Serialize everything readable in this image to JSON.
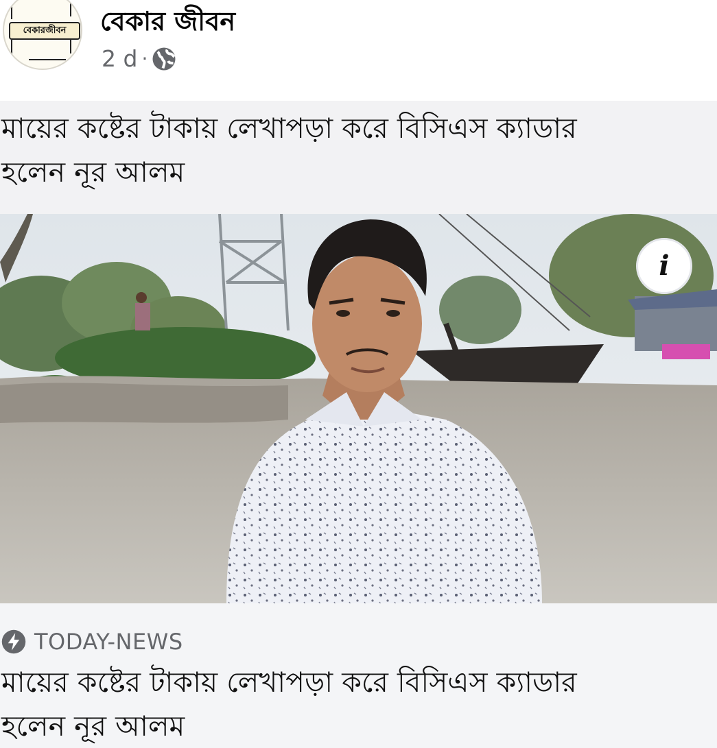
{
  "post": {
    "page_name": "বেকার জীবন",
    "avatar_text": "বেকারজীবন",
    "time": "2 d",
    "separator": "·",
    "audience_icon": "globe-icon",
    "text": "মায়ের কষ্টের টাকায় লেখাপড়া করে বিসিএস ক্যাডার\nহলেন নূর আলম"
  },
  "photo": {
    "info_label": "i",
    "info_icon": "info-icon"
  },
  "link_preview": {
    "source_icon": "lightning-icon",
    "source": "TODAY-NEWS",
    "title": "মায়ের কষ্টের টাকায় লেখাপড়া করে বিসিএস ক্যাডার\nহলেন নূর আলম"
  },
  "colors": {
    "text_primary": "#050505",
    "text_secondary": "#65676b",
    "text_background": "#f2f2f4",
    "card_background": "#f4f5f7"
  }
}
